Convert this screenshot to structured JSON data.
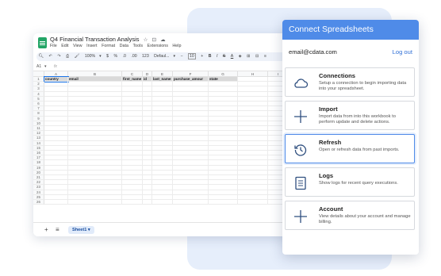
{
  "spreadsheet": {
    "title": "Q4 Financial Transaction Analysis",
    "title_icons": [
      "star-icon",
      "move-to-folder-icon",
      "cloud-status-icon"
    ],
    "menu": [
      "File",
      "Edit",
      "View",
      "Insert",
      "Format",
      "Data",
      "Tools",
      "Extensions",
      "Help"
    ],
    "toolbar": {
      "zoom": "100%",
      "currency": "$",
      "percent": "%",
      "dec_decrease": ".0",
      "dec_increase": ".00",
      "number_format": "123",
      "font": "Defaul...",
      "font_size": "10",
      "bold": "B",
      "italic": "I",
      "strike": "S",
      "text_color": "A"
    },
    "cell_ref": "A1",
    "fx": "fx",
    "columns": [
      "A",
      "B",
      "C",
      "D",
      "E",
      "F",
      "G",
      "H",
      "I"
    ],
    "header_row": [
      "country",
      "email",
      "first_name",
      "id",
      "last_name",
      "purchase_amour",
      "state"
    ],
    "row_numbers": [
      "1",
      "2",
      "3",
      "4",
      "5",
      "6",
      "7",
      "8",
      "9",
      "10",
      "11",
      "12",
      "13",
      "14",
      "15",
      "16",
      "17",
      "18",
      "19",
      "20",
      "21",
      "22",
      "23",
      "24",
      "25",
      "26"
    ],
    "add_sheet": "+",
    "all_sheets": "≡",
    "sheet_tab": "Sheet1",
    "sheet_tab_caret": "▾"
  },
  "panel": {
    "title": "Connect Spreadsheets",
    "account_email": "email@cdata.com",
    "logout_label": "Log out",
    "cards": [
      {
        "icon": "cloud-icon",
        "title": "Connections",
        "desc": "Setup a connection to begin importing data into your spreadsheet."
      },
      {
        "icon": "plus-icon",
        "title": "Import",
        "desc": "Import data from into this workbook to perform update and delete actions."
      },
      {
        "icon": "refresh-history-icon",
        "title": "Refresh",
        "desc": "Open or refresh data from past imports."
      },
      {
        "icon": "document-icon",
        "title": "Logs",
        "desc": "Show logs for recent query executions."
      },
      {
        "icon": "plus-icon",
        "title": "Account",
        "desc": "View details about your account and manage billing."
      }
    ],
    "accent_color": "#4f8be8"
  }
}
